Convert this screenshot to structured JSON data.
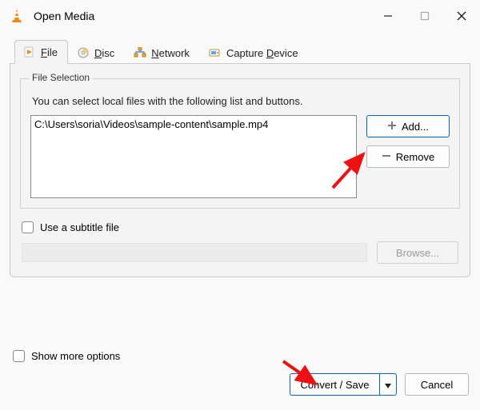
{
  "window": {
    "title": "Open Media"
  },
  "tabs": {
    "file": "File",
    "file_ul": "F",
    "disc": "Disc",
    "disc_ul": "D",
    "network": "Network",
    "network_ul": "N",
    "capture": "Capture Device",
    "capture_pre": "Capture ",
    "capture_ul": "D",
    "capture_post": "evice"
  },
  "file_selection": {
    "legend": "File Selection",
    "hint": "You can select local files with the following list and buttons.",
    "items": [
      "C:\\Users\\soria\\Videos\\sample-content\\sample.mp4"
    ],
    "add_label": "Add...",
    "remove_label": "Remove"
  },
  "subtitle": {
    "label": "Use a subtitle file",
    "browse_label": "Browse..."
  },
  "footer": {
    "show_more_pre": "Show ",
    "show_more_ul": "m",
    "show_more_post": "ore options",
    "convert_label": "Convert / Save",
    "convert_ul_pre": "C",
    "convert_ul": "o",
    "convert_ul_post": "nvert / Save",
    "cancel_label": "Cancel"
  }
}
